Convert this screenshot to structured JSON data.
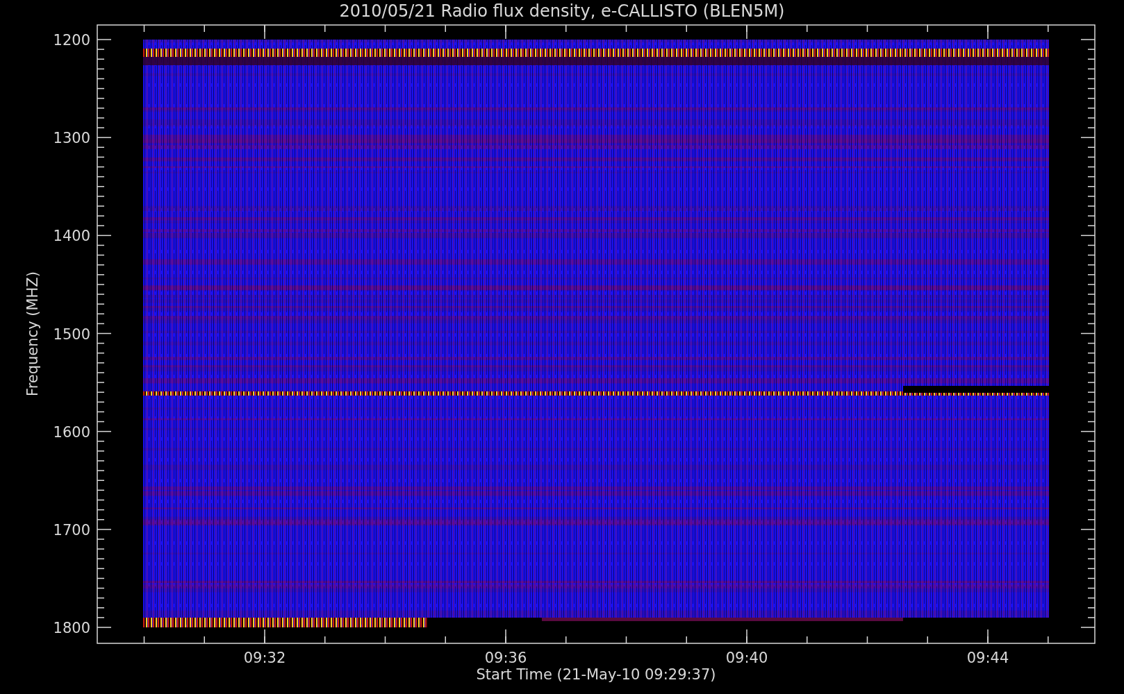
{
  "title": "2010/05/21  Radio flux density, e-CALLISTO (BLEN5M)",
  "y_axis": {
    "label": "Frequency (MHZ)",
    "ticks": [
      "1200",
      "1300",
      "1400",
      "1500",
      "1600",
      "1700",
      "1800"
    ]
  },
  "x_axis": {
    "label": "Start Time (21-May-10 09:29:37)",
    "ticks": [
      "09:32",
      "09:36",
      "09:40",
      "09:44"
    ]
  }
}
